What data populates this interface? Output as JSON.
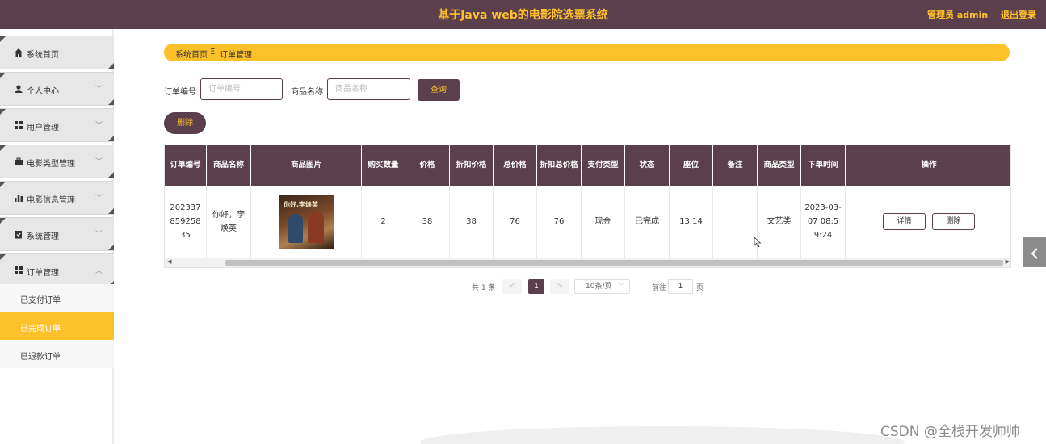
{
  "header": {
    "title": "基于Java web的电影院选票系统",
    "admin_label": "管理员 admin",
    "logout_label": "退出登录"
  },
  "sidebar": {
    "items": [
      {
        "label": "系统首页",
        "icon": "home-icon"
      },
      {
        "label": "个人中心",
        "icon": "user-icon"
      },
      {
        "label": "用户管理",
        "icon": "grid-icon"
      },
      {
        "label": "电影类型管理",
        "icon": "briefcase-icon"
      },
      {
        "label": "电影信息管理",
        "icon": "bar-chart-icon"
      },
      {
        "label": "系统管理",
        "icon": "clipboard-check-icon"
      },
      {
        "label": "订单管理",
        "icon": "grid-icon"
      }
    ],
    "sub_items": [
      {
        "label": "已支付订单",
        "active": false
      },
      {
        "label": "已完成订单",
        "active": true
      },
      {
        "label": "已退款订单",
        "active": false
      }
    ]
  },
  "breadcrumb": {
    "home": "系统首页",
    "separator": "Ξ",
    "current": "订单管理"
  },
  "search": {
    "order_no_label": "订单编号",
    "order_no_placeholder": "订单编号",
    "product_label": "商品名称",
    "product_placeholder": "商品名称",
    "query_button": "查询",
    "delete_button": "删除"
  },
  "table": {
    "headers": [
      "订单编号",
      "商品名称",
      "商品图片",
      "购买数量",
      "价格",
      "折扣价格",
      "总价格",
      "折扣总价格",
      "支付类型",
      "状态",
      "座位",
      "备注",
      "商品类型",
      "下单时间",
      "操作"
    ],
    "rows": [
      {
        "order_no": "20233785925835",
        "product_name": "你好，李焕英",
        "poster_title": "你好,李焕英",
        "quantity": "2",
        "price": "38",
        "discount_price": "38",
        "total": "76",
        "discount_total": "76",
        "pay_type": "现金",
        "status": "已完成",
        "seat": "13,14",
        "remark": "",
        "product_type": "文艺类",
        "order_time": "2023-03-07 08:59:24",
        "detail_button": "详情",
        "delete_button": "删除"
      }
    ]
  },
  "pagination": {
    "total_text": "共 1 条",
    "prev": "<",
    "current_page": "1",
    "next": ">",
    "page_size": "10条/页",
    "goto_label": "前往",
    "goto_value": "1",
    "page_suffix": "页"
  },
  "watermark": "CSDN @全栈开发帅帅",
  "colors": {
    "primary": "#5b3f4c",
    "accent": "#ffc12a"
  }
}
